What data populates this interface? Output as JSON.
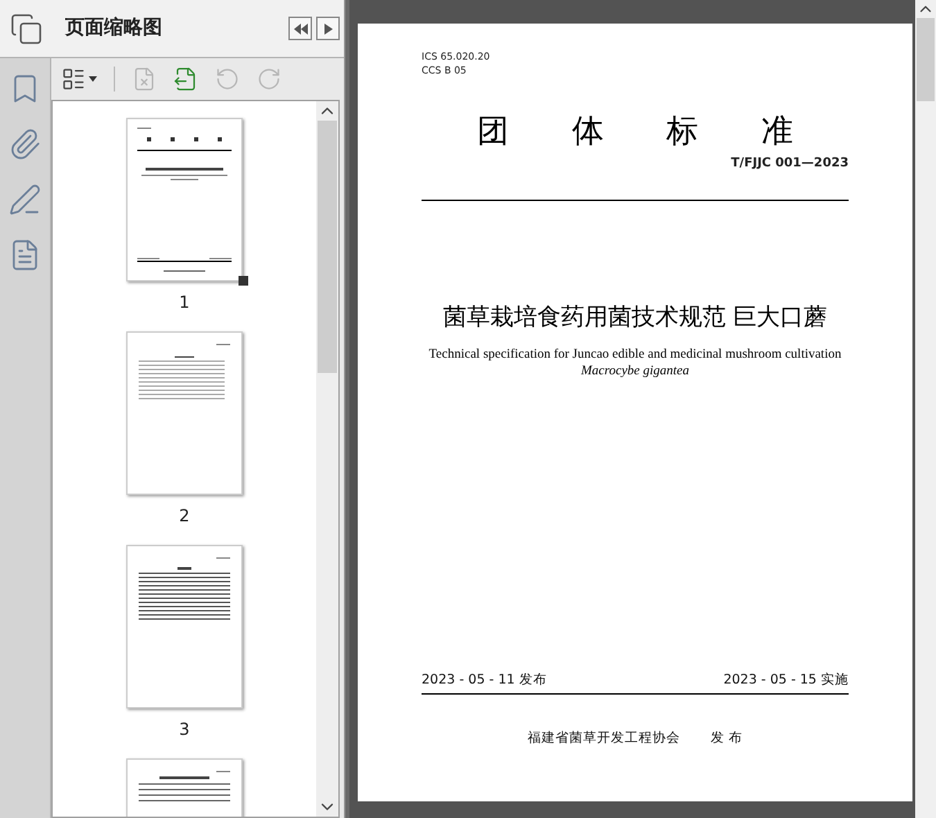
{
  "panel": {
    "title": "页面缩略图"
  },
  "panel_toolbar": [
    {
      "kind": "options",
      "disabled": false
    },
    {
      "kind": "delete",
      "disabled": true
    },
    {
      "kind": "extract",
      "disabled": false
    },
    {
      "kind": "rotate_ccw",
      "disabled": true
    },
    {
      "kind": "rotate_cw",
      "disabled": true
    }
  ],
  "side_rail": [
    {
      "kind": "bookmarks"
    },
    {
      "kind": "attachments"
    },
    {
      "kind": "signatures"
    },
    {
      "kind": "document"
    }
  ],
  "thumbnails": [
    {
      "kind": "cover",
      "number": "1",
      "selected": true
    },
    {
      "kind": "contents",
      "number": "2",
      "selected": false
    },
    {
      "kind": "foreword",
      "number": "3",
      "selected": false
    },
    {
      "kind": "body"
    }
  ],
  "document": {
    "ics": "ICS 65.020.20",
    "ccs": "CCS B 05",
    "heading": [
      "团",
      "体",
      "标",
      "准"
    ],
    "code": "T/FJJC 001—2023",
    "title_zh": "菌草栽培食药用菌技术规范 巨大口蘑",
    "title_en": "Technical specification for Juncao edible and medicinal mushroom cultivation",
    "title_en_species": "Macrocybe gigantea",
    "publish_date": "2023 - 05 - 11 发布",
    "effective_date": "2023 - 05 - 15 实施",
    "publisher": "福建省菌草开发工程协会",
    "publisher_action": "发 布"
  }
}
